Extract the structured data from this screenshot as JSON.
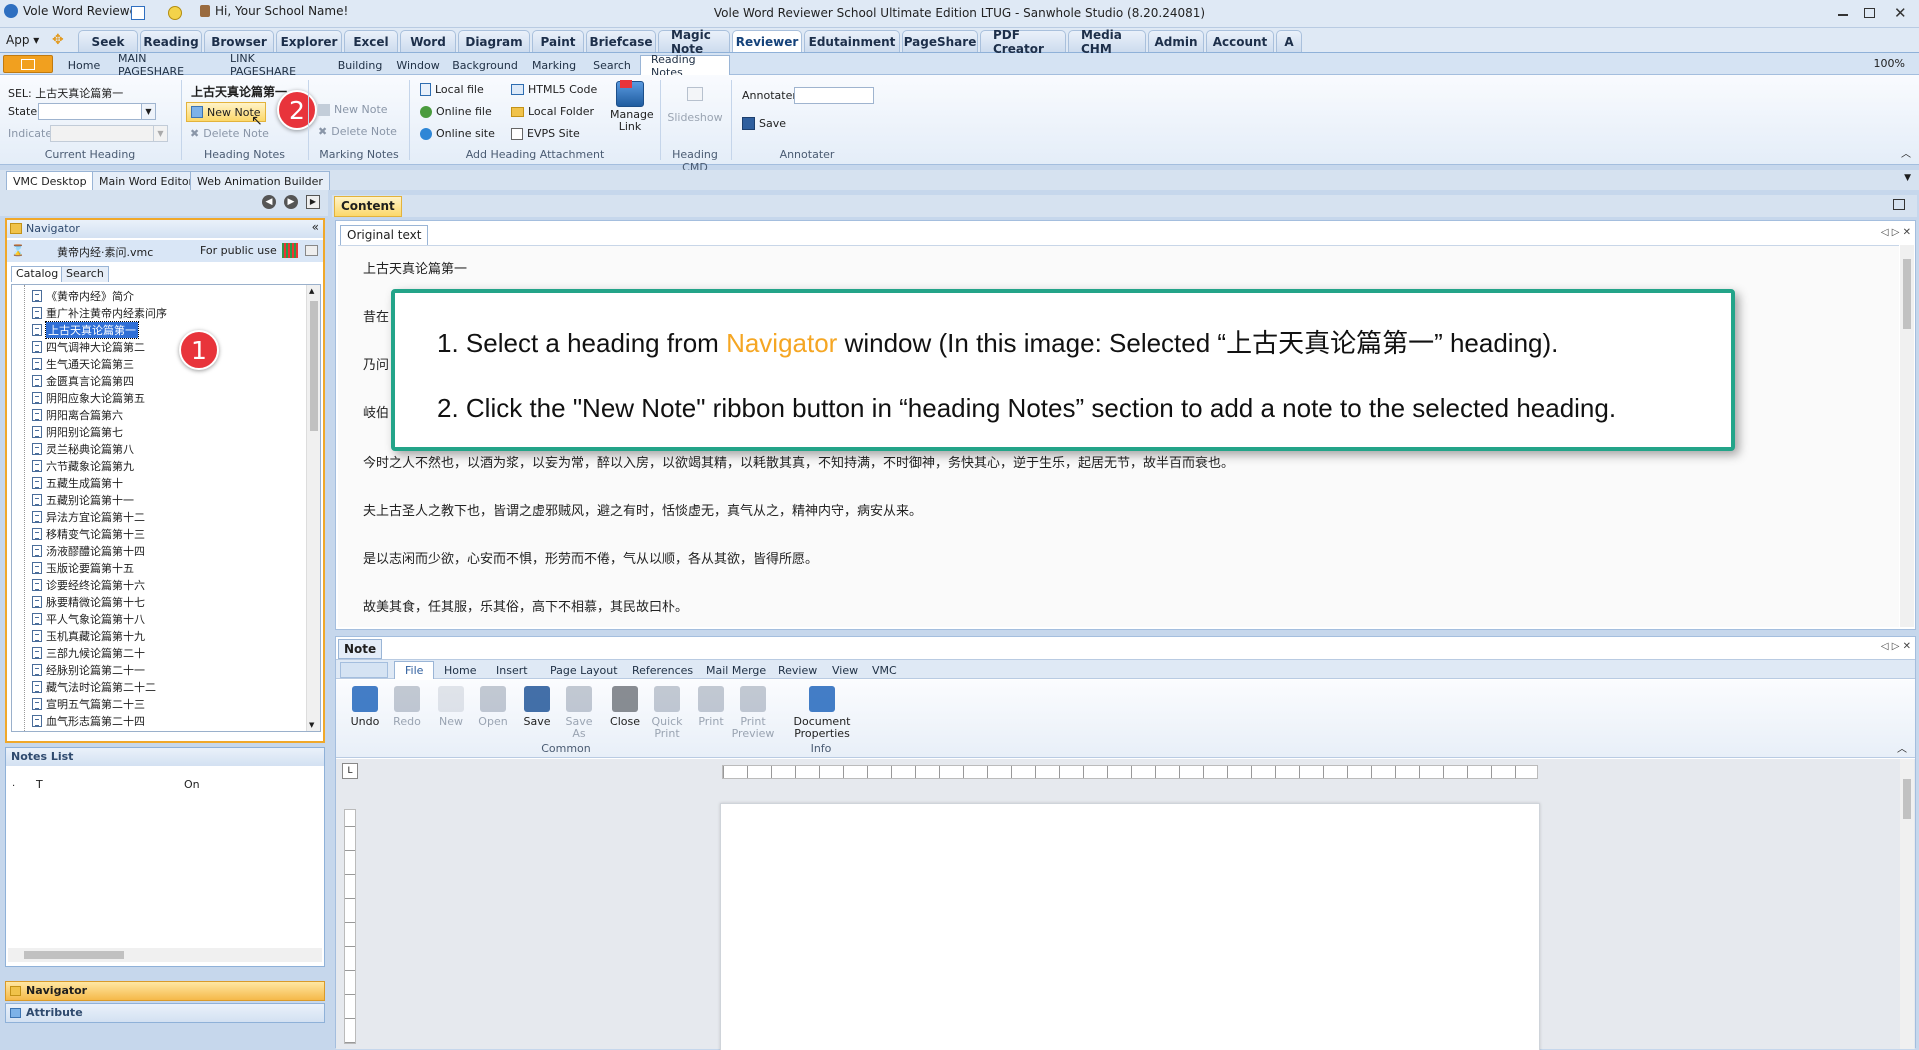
{
  "app": {
    "title": "Vole Word Reviewer",
    "greeting": "Hi, Your School Name!",
    "window_title": "Vole Word Reviewer School Ultimate Edition LTUG - Sanwhole Studio (8.20.24081)",
    "app_menu": "App"
  },
  "main_tabs": [
    "Seek",
    "Reading",
    "Browser",
    "Explorer",
    "Excel",
    "Word",
    "Diagram",
    "Paint",
    "Briefcase",
    "Magic Note",
    "Reviewer",
    "Edutainment",
    "PageShare",
    "PDF Creator",
    "Media CHM",
    "Admin",
    "Account",
    "A"
  ],
  "main_tab_active": "Reviewer",
  "sub_tabs": [
    "Home",
    "MAIN PAGESHARE",
    "LINK PAGESHARE",
    "Building",
    "Window",
    "Background",
    "Marking",
    "Search",
    "Reading Notes"
  ],
  "sub_tab_active": "Reading Notes",
  "zoom": "100%",
  "ribbon": {
    "current_heading": {
      "sel": "SEL: 上古天真论篇第一",
      "state_label": "State",
      "indicate_label": "Indicate",
      "group": "Current Heading"
    },
    "heading_notes": {
      "heading": "上古天真论篇第一",
      "new_note": "New Note",
      "delete_note": "Delete Note",
      "group": "Heading Notes"
    },
    "marking_notes": {
      "new_note": "New Note",
      "delete_note": "Delete Note",
      "group": "Marking Notes"
    },
    "attachment": {
      "local_file": "Local file",
      "online_file": "Online file",
      "online_site": "Online site",
      "html5_code": "HTML5 Code",
      "local_folder": "Local Folder",
      "evps_site": "EVPS Site",
      "manage_link": "Manage Link",
      "group": "Add Heading Attachment"
    },
    "heading_cmd": {
      "slideshow": "Slideshow",
      "group": "Heading CMD"
    },
    "annotater": {
      "label": "Annotater",
      "save": "Save",
      "group": "Annotater"
    }
  },
  "doc_tabs": [
    "VMC Desktop",
    "Main Word Editor",
    "Web Animation Builder"
  ],
  "navigator": {
    "title": "Navigator",
    "file": "黄帝内经·素问.vmc",
    "public": "For public use",
    "tabs": [
      "Catalog",
      "Search"
    ],
    "items": [
      "《黄帝内经》简介",
      "重广补注黄帝内经素问序",
      "上古天真论篇第一",
      "四气调神大论篇第二",
      "生气通天论篇第三",
      "金匮真言论篇第四",
      "阴阳应象大论篇第五",
      "阴阳离合篇第六",
      "阴阳别论篇第七",
      "灵兰秘典论篇第八",
      "六节藏象论篇第九",
      "五藏生成篇第十",
      "五藏别论篇第十一",
      "异法方宜论篇第十二",
      "移精变气论篇第十三",
      "汤液醪醴论篇第十四",
      "玉版论要篇第十五",
      "诊要经终论篇第十六",
      "脉要精微论篇第十七",
      "平人气象论篇第十八",
      "玉机真藏论篇第十九",
      "三部九候论篇第二十",
      "经脉别论篇第二十一",
      "藏气法时论篇第二十二",
      "宣明五气篇第二十三",
      "血气形志篇第二十四"
    ]
  },
  "notes_list": {
    "title": "Notes List",
    "col_dot": ".",
    "col_t": "T",
    "col_on": "On"
  },
  "bottom_nav": {
    "navigator": "Navigator",
    "attribute": "Attribute"
  },
  "content": {
    "tab": "Content",
    "subtab": "Original text",
    "lines": [
      "上古天真论篇第一",
      "昔在",
      "乃问",
      "岐伯",
      "今时之人不然也，以酒为浆，以妄为常，醉以入房，以欲竭其精，以耗散其真，不知持满，不时御神，务快其心，逆于生乐，起居无节，故半百而衰也。",
      "夫上古圣人之教下也，皆谓之虚邪贼风，避之有时，恬惔虚无，真气从之，精神内守，病安从来。",
      "是以志闲而少欲，心安而不惧，形劳而不倦，气从以顺，各从其欲，皆得所愿。",
      "故美其食，任其服，乐其俗，高下不相慕，其民故曰朴。"
    ]
  },
  "note": {
    "tab": "Note",
    "tabs": [
      "File",
      "Home",
      "Insert",
      "Page Layout",
      "References",
      "Mail Merge",
      "Review",
      "View",
      "VMC"
    ],
    "tools": [
      "Undo",
      "Redo",
      "New",
      "Open",
      "Save",
      "Save As",
      "Close",
      "Quick Print",
      "Print",
      "Print Preview",
      "Document Properties"
    ],
    "groups": {
      "common": "Common",
      "info": "Info"
    }
  },
  "annotations": {
    "step1_num": "1",
    "step2_num": "2",
    "line1_prefix": "1. Select a heading from ",
    "line1_highlight": "Navigator",
    "line1_suffix": " window (In this image: Selected “上古天真论篇第一”   heading).",
    "line2": "2. Click the \"New Note\" ribbon button in “heading Notes” section to add a note to the selected heading."
  },
  "colors": {
    "accent_orange": "#f5a623",
    "callout_border": "#23a489",
    "badge_red": "#e8343b",
    "ribbon_blue": "#dfe9f5"
  }
}
